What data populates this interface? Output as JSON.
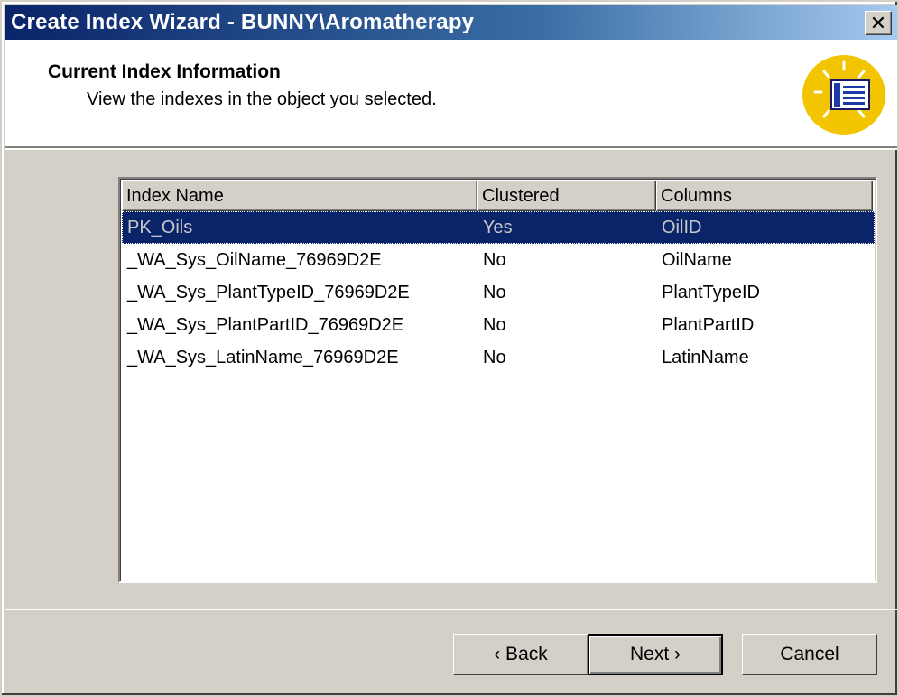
{
  "window": {
    "title": "Create Index Wizard - BUNNY\\Aromatherapy",
    "close_glyph": "✕"
  },
  "header": {
    "title": "Current Index Information",
    "subtitle": "View the indexes in the object you selected."
  },
  "table": {
    "columns": [
      "Index Name",
      "Clustered",
      "Columns"
    ],
    "rows": [
      {
        "name": "PK_Oils",
        "clustered": "Yes",
        "columns": "OilID",
        "selected": true
      },
      {
        "name": "_WA_Sys_OilName_76969D2E",
        "clustered": "No",
        "columns": "OilName",
        "selected": false
      },
      {
        "name": "_WA_Sys_PlantTypeID_76969D2E",
        "clustered": "No",
        "columns": "PlantTypeID",
        "selected": false
      },
      {
        "name": "_WA_Sys_PlantPartID_76969D2E",
        "clustered": "No",
        "columns": "PlantPartID",
        "selected": false
      },
      {
        "name": "_WA_Sys_LatinName_76969D2E",
        "clustered": "No",
        "columns": "LatinName",
        "selected": false
      }
    ]
  },
  "buttons": {
    "back": "‹ Back",
    "next": "Next ›",
    "cancel": "Cancel"
  },
  "colors": {
    "title_bar_start": "#0a246a",
    "selection": "#0a246a",
    "icon_circle": "#f2c500"
  }
}
